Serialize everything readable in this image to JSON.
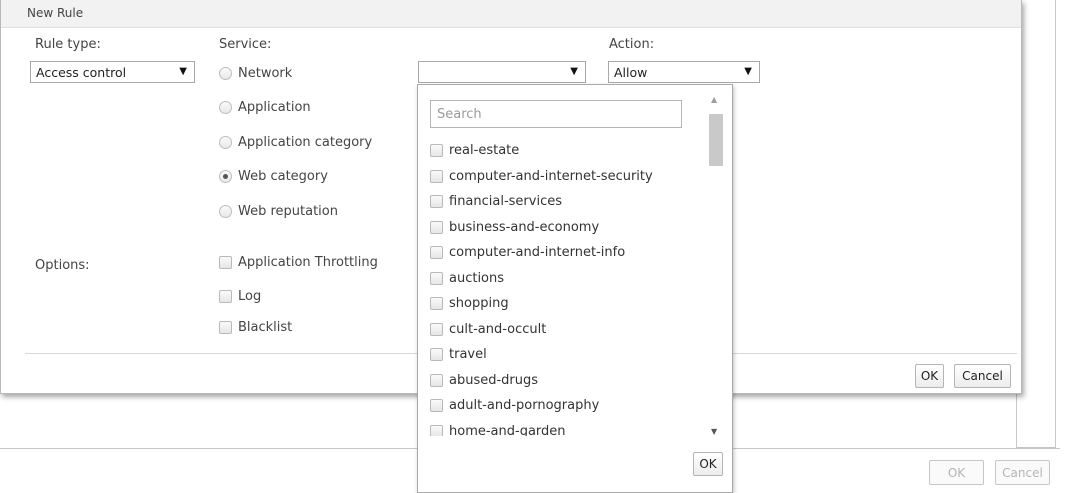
{
  "dialog": {
    "title": "New Rule",
    "ok_label": "OK",
    "cancel_label": "Cancel"
  },
  "rule_type": {
    "label": "Rule type:",
    "selected": "Access control"
  },
  "service": {
    "label": "Service:",
    "options": [
      {
        "label": "Network",
        "checked": false
      },
      {
        "label": "Application",
        "checked": false
      },
      {
        "label": "Application category",
        "checked": false
      },
      {
        "label": "Web category",
        "checked": true
      },
      {
        "label": "Web reputation",
        "checked": false
      }
    ],
    "dropdown_value": ""
  },
  "action": {
    "label": "Action:",
    "selected": "Allow"
  },
  "options": {
    "label": "Options:",
    "items": [
      {
        "label": "Application Throttling",
        "checked": false
      },
      {
        "label": "Log",
        "checked": false
      },
      {
        "label": "Blacklist",
        "checked": false
      }
    ]
  },
  "web_category_dropdown": {
    "search_placeholder": "Search",
    "ok_label": "OK",
    "items": [
      "real-estate",
      "computer-and-internet-security",
      "financial-services",
      "business-and-economy",
      "computer-and-internet-info",
      "auctions",
      "shopping",
      "cult-and-occult",
      "travel",
      "abused-drugs",
      "adult-and-pornography",
      "home-and-garden"
    ]
  },
  "background": {
    "ok_label": "OK",
    "cancel_label": "Cancel"
  }
}
